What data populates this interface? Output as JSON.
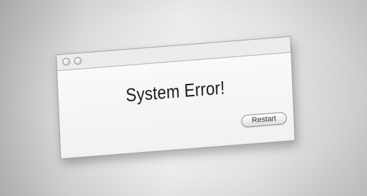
{
  "dialog": {
    "message": "System Error!",
    "restart_label": "Restart"
  },
  "titlebar": {
    "buttons": [
      "close-icon",
      "minimize-icon"
    ]
  },
  "colors": {
    "background": "#dcdcdc",
    "dialog_face": "#f5f5f5",
    "text": "#1a1a1a",
    "border": "#a9a9a9"
  }
}
